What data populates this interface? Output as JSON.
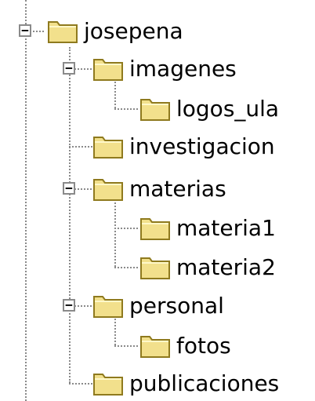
{
  "tree": {
    "toggle_expanded_symbol": "−",
    "nodes": {
      "josepena": {
        "label": "josepena",
        "expanded": true
      },
      "imagenes": {
        "label": "imagenes",
        "expanded": true
      },
      "logos_ula": {
        "label": "logos_ula"
      },
      "investigacion": {
        "label": "investigacion"
      },
      "materias": {
        "label": "materias",
        "expanded": true
      },
      "materia1": {
        "label": "materia1"
      },
      "materia2": {
        "label": "materia2"
      },
      "personal": {
        "label": "personal",
        "expanded": true
      },
      "fotos": {
        "label": "fotos"
      },
      "publicaciones": {
        "label": "publicaciones"
      }
    },
    "icon": "folder-icon",
    "colors": {
      "folder_fill": "#f2e08c",
      "folder_edge": "#8f7a1e",
      "connector": "#8a8a8a"
    }
  }
}
